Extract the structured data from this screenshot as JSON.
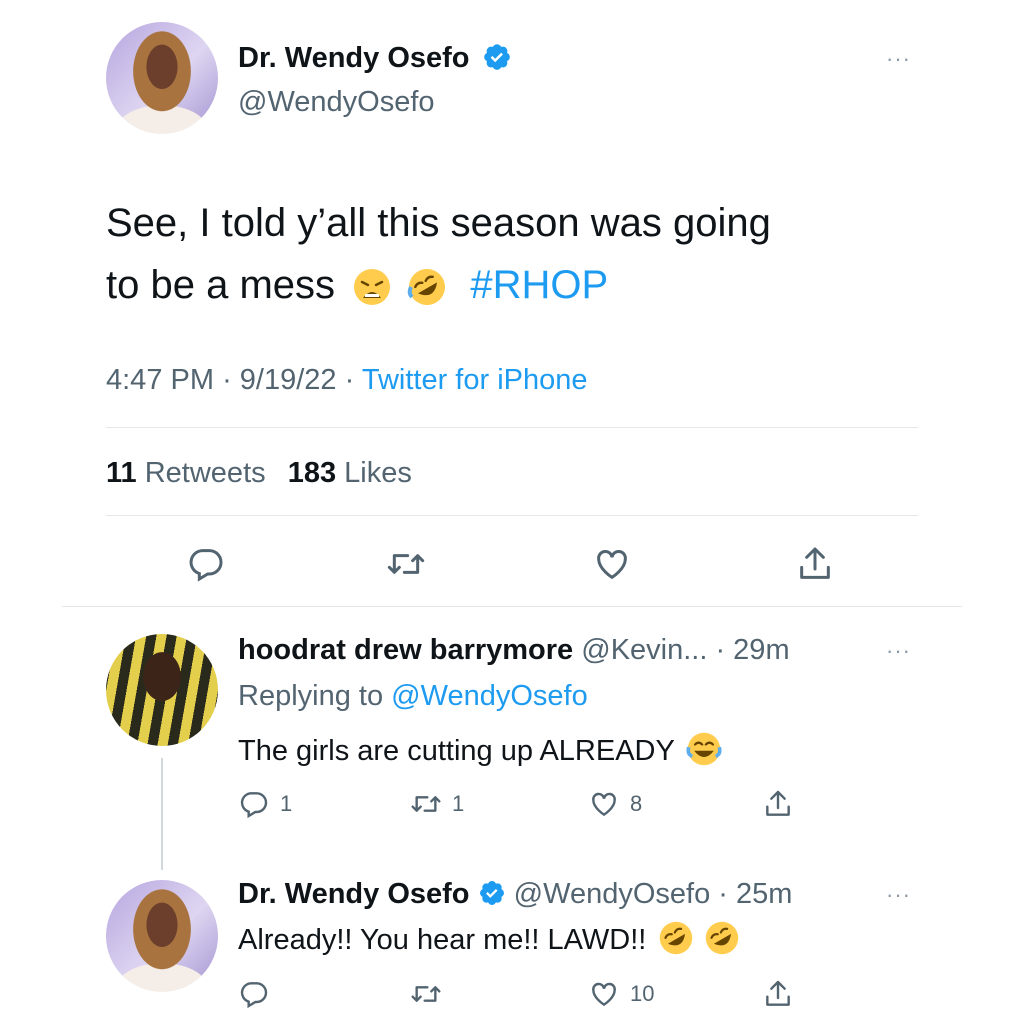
{
  "main_tweet": {
    "display_name": "Dr. Wendy Osefo",
    "handle": "@WendyOsefo",
    "text_line1": "See, I told y’all this season was going",
    "text_line2": "to be a mess",
    "hashtag": "#RHOP",
    "time": "4:47 PM",
    "date": "9/19/22",
    "source": "Twitter for iPhone",
    "retweets_count": "11",
    "retweets_label": "Retweets",
    "likes_count": "183",
    "likes_label": "Likes"
  },
  "replies": [
    {
      "display_name": "hoodrat drew barrymore",
      "handle": "@Kevin...",
      "time": "· 29m",
      "replying_prefix": "Replying to",
      "replying_to": "@WendyOsefo",
      "text": "The girls are cutting up ALREADY",
      "reply_count": "1",
      "retweet_count": "1",
      "like_count": "8"
    },
    {
      "display_name": "Dr. Wendy Osefo",
      "handle": "@WendyOsefo",
      "time": "· 25m",
      "text": "Already!! You hear me!! LAWD!!",
      "reply_count": "",
      "retweet_count": "",
      "like_count": "10"
    }
  ],
  "more_label": "···",
  "dot": "·",
  "colors": {
    "accent": "#1d9bf0",
    "muted": "#536471",
    "divider": "#e4e8ea"
  },
  "icons": [
    "reply-icon",
    "retweet-icon",
    "like-icon",
    "share-icon",
    "verified-badge-icon",
    "more-icon",
    "weary-face-emoji",
    "rofl-emoji",
    "tears-of-joy-emoji"
  ]
}
